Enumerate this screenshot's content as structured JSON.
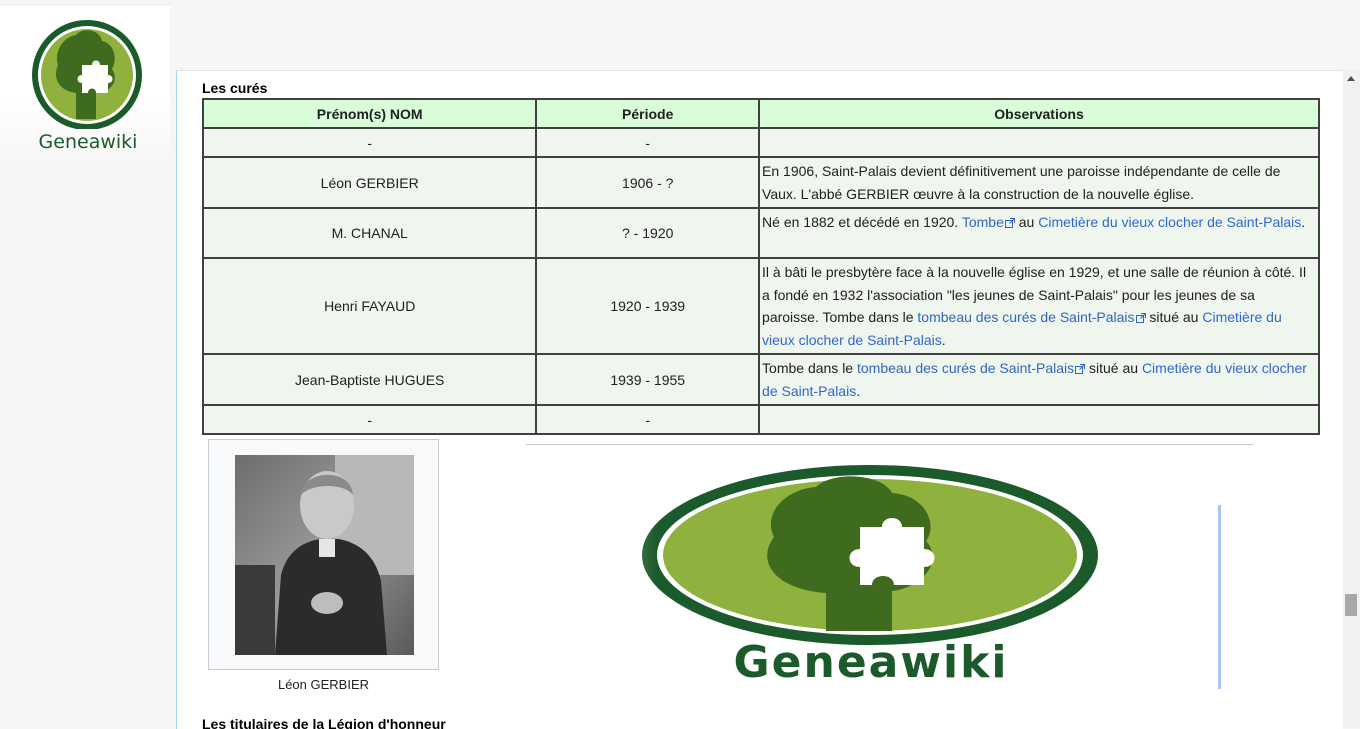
{
  "logo": {
    "text": "Geneawiki"
  },
  "section_cures": {
    "title": "Les curés"
  },
  "table": {
    "headers": [
      "Prénom(s) NOM",
      "Période",
      "Observations"
    ],
    "rows": [
      {
        "name": "-",
        "period": "-"
      },
      {
        "name": "Léon GERBIER",
        "period": "1906 - ?",
        "obs": "En 1906, Saint-Palais devient définitivement une paroisse indépendante de celle de Vaux. L'abbé GERBIER œuvre à la construction de la nouvelle église."
      },
      {
        "name": "M. CHANAL",
        "period": "? - 1920",
        "obs_pre": "Né en 1882 et décédé en 1920. ",
        "obs_link1": "Tombe",
        "obs_mid": " au ",
        "obs_link2": "Cimetière du vieux clocher de Saint-Palais",
        "obs_post": "."
      },
      {
        "name": "Henri FAYAUD",
        "period": "1920 - 1939",
        "obs_pre": "Il à bâti le presbytère face à la nouvelle église en 1929, et une salle de réunion à côté. Il a fondé en 1932 l'association \"les jeunes de Saint-Palais\" pour les jeunes de sa paroisse. Tombe dans le ",
        "obs_link1": "tombeau des curés de Saint-Palais",
        "obs_mid": " situé au ",
        "obs_link2": "Cimetière du vieux clocher de Saint-Palais",
        "obs_post": "."
      },
      {
        "name": "Jean-Baptiste HUGUES",
        "period": "1939 - 1955",
        "obs_pre": "Tombe dans le ",
        "obs_link1": "tombeau des curés de Saint-Palais",
        "obs_mid": " situé au ",
        "obs_link2": "Cimetière du vieux clocher de Saint-Palais",
        "obs_post": "."
      },
      {
        "name": "-",
        "period": "-"
      }
    ]
  },
  "thumbnail": {
    "caption": "Léon GERBIER"
  },
  "big_logo": {
    "text": "Geneawiki"
  },
  "section_legion": {
    "title": "Les titulaires de la Légion d'honneur"
  },
  "colors": {
    "header_bg": "#d9fdd9",
    "cell_bg": "#eef6ee",
    "link": "#3366cc",
    "logo_green": "#1b5a2a",
    "logo_light": "#8fb23e"
  }
}
